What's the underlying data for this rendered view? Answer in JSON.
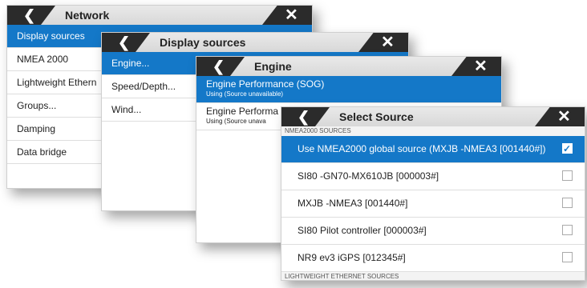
{
  "network": {
    "title": "Network",
    "items": [
      "Display sources",
      "NMEA 2000",
      "Lightweight Ethern",
      "Groups...",
      "Damping",
      "Data bridge"
    ]
  },
  "display_sources": {
    "title": "Display sources",
    "items": [
      "Engine...",
      "Speed/Depth...",
      "Wind..."
    ]
  },
  "engine": {
    "title": "Engine",
    "items": [
      {
        "label": "Engine Performance (SOG)",
        "sub": "Using (Source unavailable)"
      },
      {
        "label": "Engine Performa",
        "sub": "Using (Source unava"
      }
    ]
  },
  "select_source": {
    "title": "Select Source",
    "section1": "NMEA2000 SOURCES",
    "sources": [
      {
        "label": "Use NMEA2000 global source (MXJB -NMEA3 [001440#])",
        "checked": true
      },
      {
        "label": "SI80 -GN70-MX610JB [000003#]",
        "checked": false
      },
      {
        "label": "MXJB -NMEA3 [001440#]",
        "checked": false
      },
      {
        "label": "SI80 Pilot controller [000003#]",
        "checked": false
      },
      {
        "label": "NR9 ev3 iGPS [012345#]",
        "checked": false
      }
    ],
    "section2": "LIGHTWEIGHT ETHERNET SOURCES"
  },
  "glyphs": {
    "back": "❮",
    "close": "✕"
  },
  "colors": {
    "accent": "#1478c8",
    "header_dark": "#2b2b2b"
  }
}
